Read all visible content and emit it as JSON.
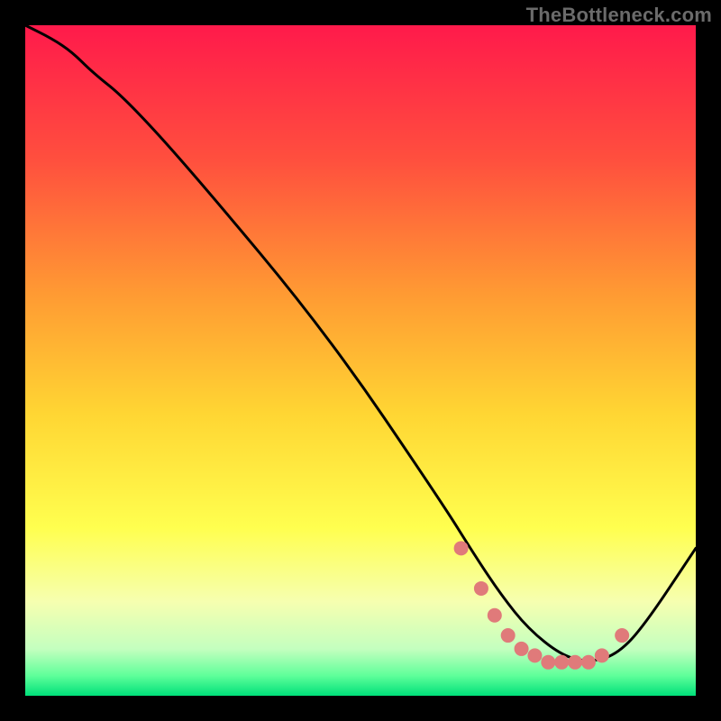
{
  "watermark": "TheBottleneck.com",
  "chart_data": {
    "type": "line",
    "title": "",
    "xlabel": "",
    "ylabel": "",
    "xlim": [
      0,
      100
    ],
    "ylim": [
      0,
      100
    ],
    "grid": false,
    "legend": false,
    "gradient_stops": [
      {
        "pct": 0,
        "color": "#ff1a4b"
      },
      {
        "pct": 20,
        "color": "#ff4f3e"
      },
      {
        "pct": 40,
        "color": "#ff9a33"
      },
      {
        "pct": 58,
        "color": "#ffd633"
      },
      {
        "pct": 75,
        "color": "#ffff4f"
      },
      {
        "pct": 86,
        "color": "#f6ffb0"
      },
      {
        "pct": 93,
        "color": "#c4ffbf"
      },
      {
        "pct": 97,
        "color": "#5fff9a"
      },
      {
        "pct": 100,
        "color": "#00e07a"
      }
    ],
    "series": [
      {
        "name": "bottleneck-curve",
        "color": "#000000",
        "x": [
          0,
          4,
          7,
          10,
          15,
          25,
          45,
          62,
          67,
          71,
          75,
          80,
          84,
          88,
          92,
          100
        ],
        "y": [
          100,
          98,
          96,
          93,
          89,
          78,
          54,
          29,
          21,
          15,
          10,
          6,
          5,
          6,
          10,
          22
        ]
      }
    ],
    "markers": {
      "name": "highlight-dots",
      "color": "#e07a7a",
      "radius": 8,
      "x": [
        65,
        68,
        70,
        72,
        74,
        76,
        78,
        80,
        82,
        84,
        86,
        89
      ],
      "y": [
        22,
        16,
        12,
        9,
        7,
        6,
        5,
        5,
        5,
        5,
        6,
        9
      ]
    }
  }
}
